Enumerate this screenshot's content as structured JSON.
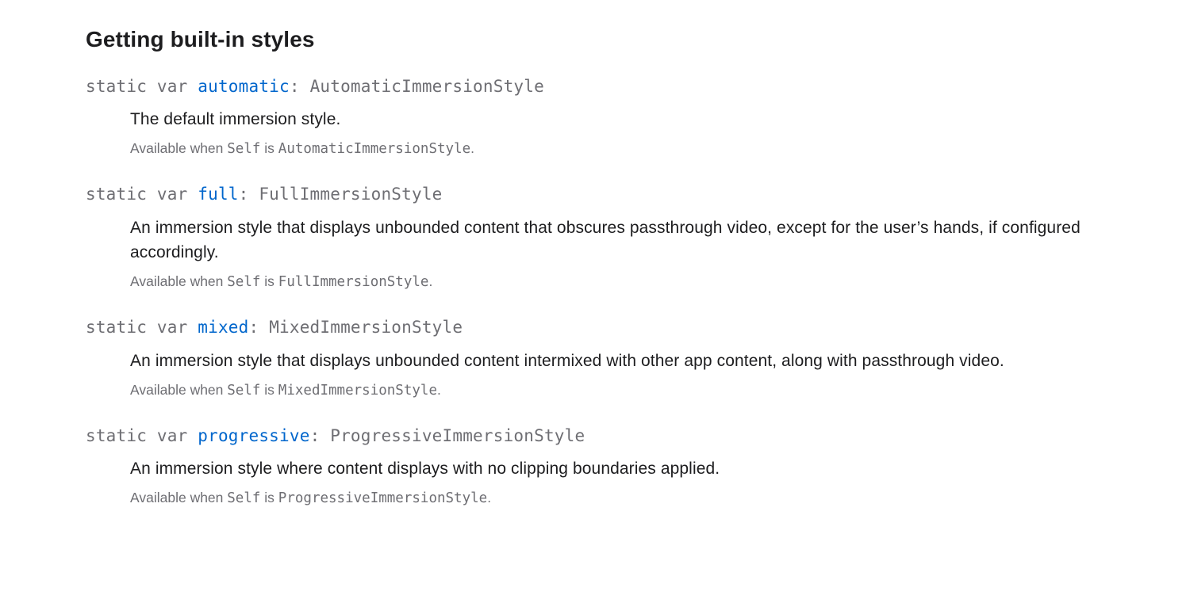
{
  "section": {
    "title": "Getting built-in styles"
  },
  "availability_prefix": "Available when ",
  "availability_mid": " is ",
  "availability_suffix": ".",
  "self_label": "Self",
  "decl_prefix_static_var": "static var ",
  "colon_space": ": ",
  "topics": [
    {
      "identifier": "automatic",
      "type": "AutomaticImmersionStyle",
      "abstract": "The default immersion style.",
      "conformance_type": "AutomaticImmersionStyle"
    },
    {
      "identifier": "full",
      "type": "FullImmersionStyle",
      "abstract": "An immersion style that displays unbounded content that obscures passthrough video, except for the user’s hands, if configured accordingly.",
      "conformance_type": "FullImmersionStyle"
    },
    {
      "identifier": "mixed",
      "type": "MixedImmersionStyle",
      "abstract": "An immersion style that displays unbounded content intermixed with other app content, along with passthrough video.",
      "conformance_type": "MixedImmersionStyle"
    },
    {
      "identifier": "progressive",
      "type": "ProgressiveImmersionStyle",
      "abstract": "An immersion style where content displays with no clipping boundaries applied.",
      "conformance_type": "ProgressiveImmersionStyle"
    }
  ]
}
